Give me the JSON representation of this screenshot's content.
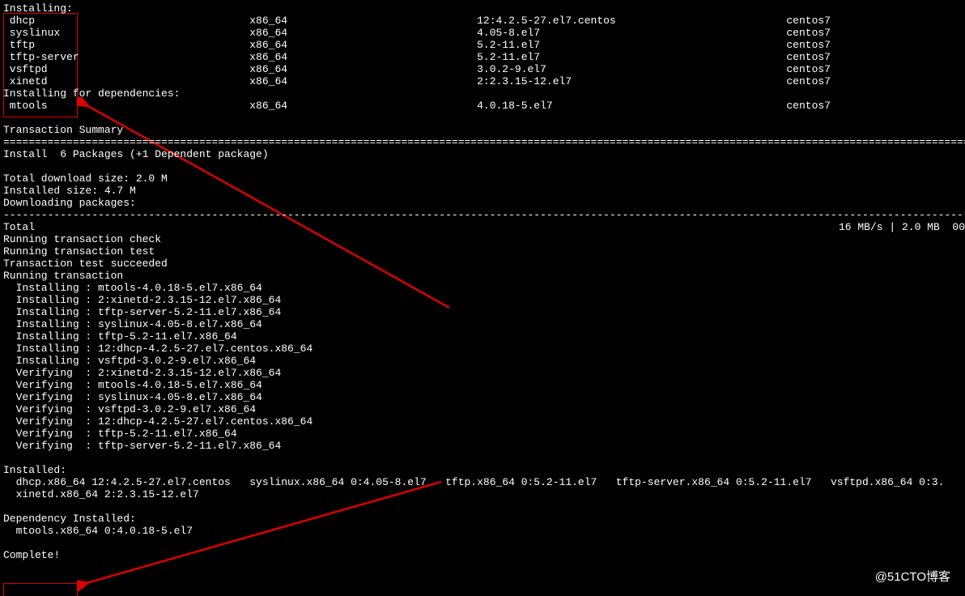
{
  "header": "Installing:",
  "packages": [
    {
      "name": "dhcp",
      "arch": "x86_64",
      "ver": "12:4.2.5-27.el7.centos",
      "repo": "centos7"
    },
    {
      "name": "syslinux",
      "arch": "x86_64",
      "ver": "4.05-8.el7",
      "repo": "centos7"
    },
    {
      "name": "tftp",
      "arch": "x86_64",
      "ver": "5.2-11.el7",
      "repo": "centos7"
    },
    {
      "name": "tftp-server",
      "arch": "x86_64",
      "ver": "5.2-11.el7",
      "repo": "centos7"
    },
    {
      "name": "vsftpd",
      "arch": "x86_64",
      "ver": "3.0.2-9.el7",
      "repo": "centos7"
    },
    {
      "name": "xinetd",
      "arch": "x86_64",
      "ver": "2:2.3.15-12.el7",
      "repo": "centos7"
    }
  ],
  "deps_header": "Installing for dependencies:",
  "deps": [
    {
      "name": "mtools",
      "arch": "x86_64",
      "ver": "4.0.18-5.el7",
      "repo": "centos7"
    }
  ],
  "summary_title": "Transaction Summary",
  "divider": "================================================================================================================================================================",
  "install_line": "Install  6 Packages (+1 Dependent package)",
  "dl_size": "Total download size: 2.0 M",
  "inst_size": "Installed size: 4.7 M",
  "dl_pkgs": "Downloading packages:",
  "dashes": "--------------------------------------------------------------------------------------------------------------------------------------------------------------------------",
  "total_line": {
    "label": "Total",
    "speed": "16 MB/s | 2.0 MB  00"
  },
  "trans_check": "Running transaction check",
  "trans_test": "Running transaction test",
  "trans_ok": "Transaction test succeeded",
  "trans_run": "Running transaction",
  "install_steps": [
    "  Installing : mtools-4.0.18-5.el7.x86_64",
    "  Installing : 2:xinetd-2.3.15-12.el7.x86_64",
    "  Installing : tftp-server-5.2-11.el7.x86_64",
    "  Installing : syslinux-4.05-8.el7.x86_64",
    "  Installing : tftp-5.2-11.el7.x86_64",
    "  Installing : 12:dhcp-4.2.5-27.el7.centos.x86_64",
    "  Installing : vsftpd-3.0.2-9.el7.x86_64",
    "  Verifying  : 2:xinetd-2.3.15-12.el7.x86_64",
    "  Verifying  : mtools-4.0.18-5.el7.x86_64",
    "  Verifying  : syslinux-4.05-8.el7.x86_64",
    "  Verifying  : vsftpd-3.0.2-9.el7.x86_64",
    "  Verifying  : 12:dhcp-4.2.5-27.el7.centos.x86_64",
    "  Verifying  : tftp-5.2-11.el7.x86_64",
    "  Verifying  : tftp-server-5.2-11.el7.x86_64"
  ],
  "installed_label": "Installed:",
  "installed_line_1": "  dhcp.x86_64 12:4.2.5-27.el7.centos   syslinux.x86_64 0:4.05-8.el7   tftp.x86_64 0:5.2-11.el7   tftp-server.x86_64 0:5.2-11.el7   vsftpd.x86_64 0:3.",
  "installed_line_2": "  xinetd.x86_64 2:2.3.15-12.el7",
  "dep_installed_label": "Dependency Installed:",
  "dep_installed_line": "  mtools.x86_64 0:4.0.18-5.el7",
  "complete": "Complete!",
  "watermark": "@51CTO博客",
  "cols": {
    "name": 1,
    "arch": 39,
    "ver": 75,
    "repo": 124
  }
}
